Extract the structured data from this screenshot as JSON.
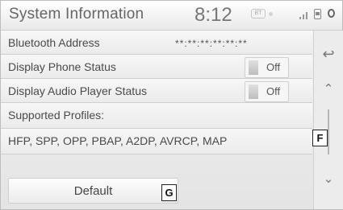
{
  "header": {
    "title": "System Information",
    "time": "8:12",
    "icons": [
      "bluetooth-badge-icon",
      "status-dot-icon",
      "signal-bars-icon",
      "phone-battery-icon",
      "settings-icon"
    ]
  },
  "rows": [
    {
      "label": "Bluetooth Address",
      "value": "**:**:**:**:**:**"
    },
    {
      "label": "Display Phone Status",
      "toggle": "Off"
    },
    {
      "label": "Display Audio Player Status",
      "toggle": "Off"
    },
    {
      "label": "Supported Profiles:"
    },
    {
      "label": "HFP, SPP, OPP, PBAP, A2DP, AVRCP, MAP"
    }
  ],
  "default_button": {
    "label": "Default"
  },
  "sidebar": {
    "back_icon": "↩",
    "up_icon": "⌃",
    "down_icon": "⌄"
  },
  "callouts": {
    "f": "F",
    "g": "G"
  }
}
